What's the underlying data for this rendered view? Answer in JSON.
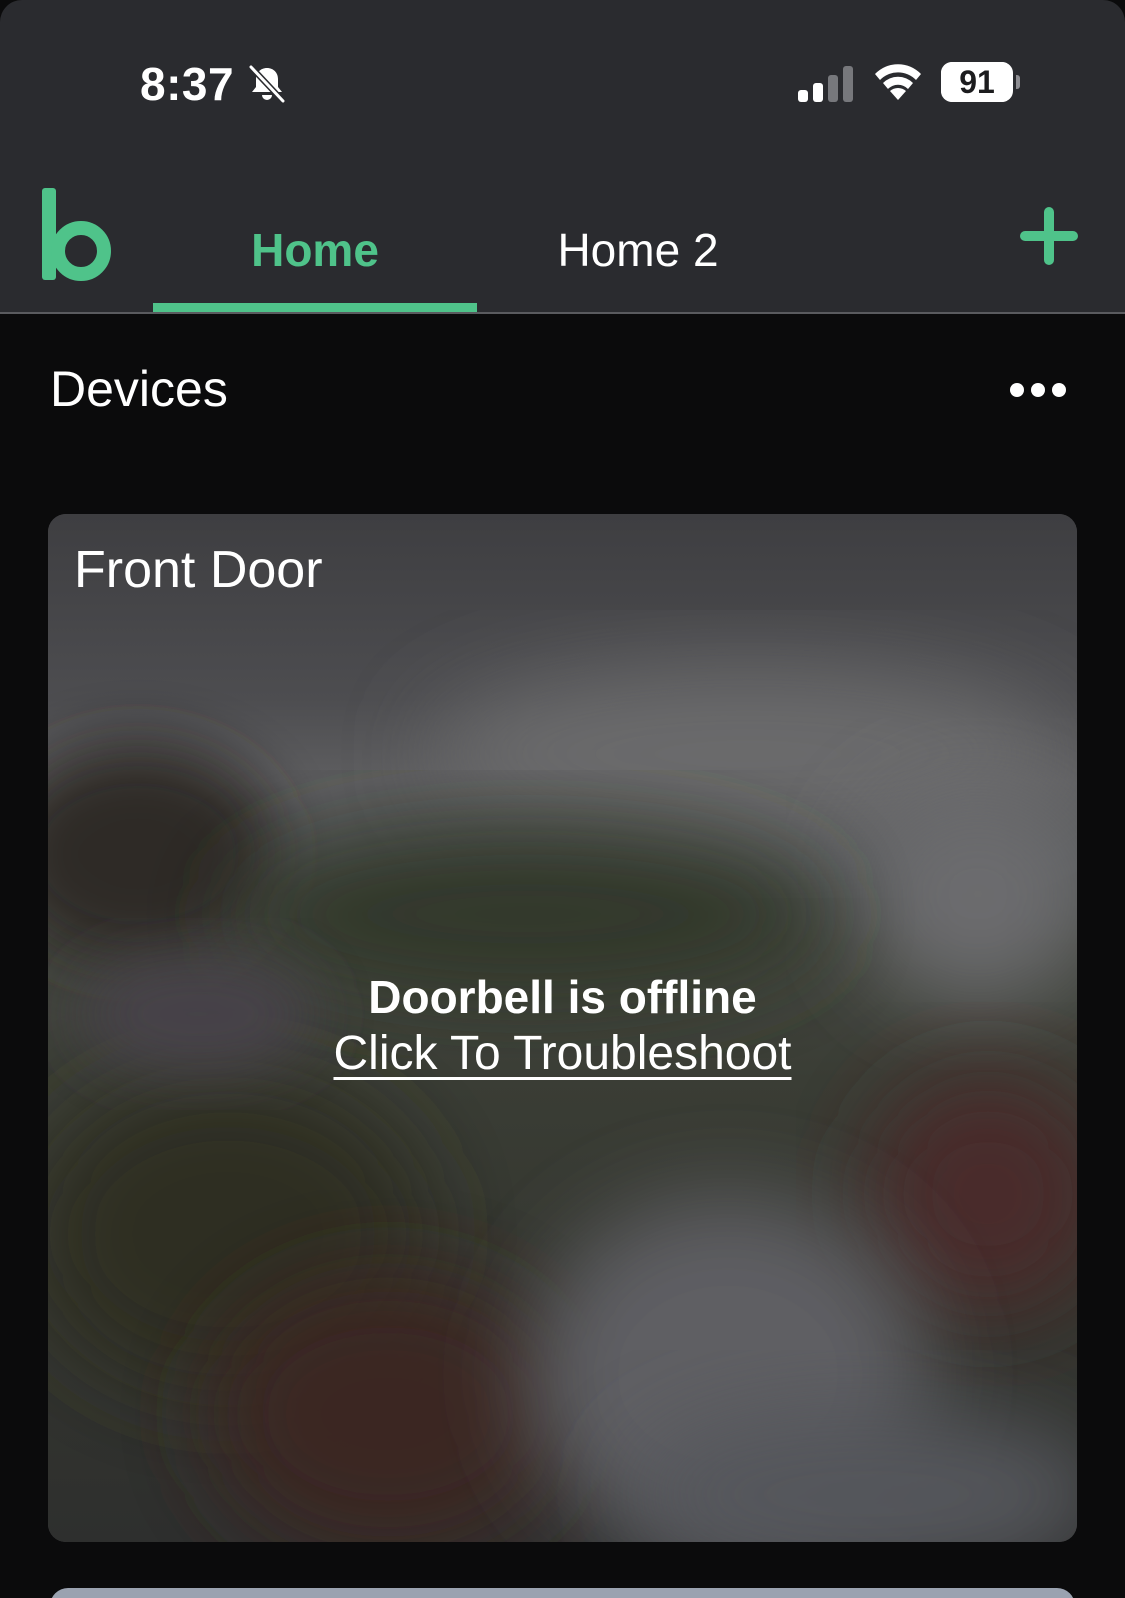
{
  "status_bar": {
    "time": "8:37",
    "battery_percent": "91",
    "battery_level": 0.91,
    "signal_bars_active": 2,
    "signal_bars_total": 4
  },
  "header": {
    "tabs": [
      {
        "label": "Home",
        "active": true
      },
      {
        "label": "Home 2",
        "active": false
      }
    ]
  },
  "colors": {
    "accent": "#4fc38a",
    "header_bg": "#2a2b2f",
    "page_bg": "#0b0b0c"
  },
  "devices": {
    "title": "Devices",
    "cards": [
      {
        "name": "Front Door",
        "status": "Doorbell is offline",
        "action": "Click To Troubleshoot"
      }
    ]
  }
}
